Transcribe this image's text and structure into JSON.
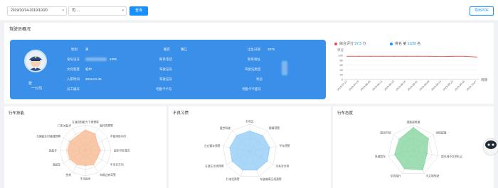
{
  "toolbar": {
    "date_range": "2019/10/14-2019/10/20",
    "driver_select": "司 …",
    "query_label": "查询",
    "export_label": "导出PDF"
  },
  "overview": {
    "title": "驾驶员概况",
    "name": "张",
    "company": "一公司",
    "fields": [
      {
        "label": "性别",
        "value": "男"
      },
      {
        "label": "身份证号",
        "value": "4355"
      },
      {
        "label": "文化程度",
        "value": "初中"
      },
      {
        "label": "入职时间",
        "value": "2015.01.25"
      },
      {
        "label": "员工编号",
        "value": ""
      },
      {
        "label": "籍贯",
        "value": "镇江"
      },
      {
        "label": "联系电话",
        "value": ""
      },
      {
        "label": "驾驶证号",
        "value": ""
      },
      {
        "label": "驾驶证号",
        "value": ""
      },
      {
        "label": "考勤卡卡号",
        "value": ""
      },
      {
        "label": "出生日期",
        "value": "1975."
      },
      {
        "label": "联系地址",
        "value": ""
      },
      {
        "label": "驾驶证类型",
        "value": ""
      },
      {
        "label": "状态",
        "value": ""
      },
      {
        "label": "考勤卡卡面号",
        "value": ""
      }
    ]
  },
  "score": {
    "composite_label": "综合评分",
    "composite_value": "97.5",
    "composite_unit": "分",
    "rank_label": "排名 第",
    "rank_value": "11/20",
    "rank_unit": "名",
    "ylabel": "评分",
    "xlabel": "周期",
    "colors": {
      "composite": "#e0524f",
      "rank": "#1890ff"
    }
  },
  "chart_data": [
    {
      "type": "line",
      "ylabel": "评分",
      "xlabel": "周期",
      "ylim": [
        0,
        100
      ],
      "yticks": [
        100,
        80,
        60,
        40,
        20,
        0
      ],
      "x": [
        "2019-07-22",
        "2019-07-29",
        "2019-08-05",
        "2019-08-12",
        "2019-08-19",
        "2019-08-26",
        "2019-09-02",
        "2019-09-09",
        "2019-09-16",
        "2019-09-23",
        "2019-09-30",
        "2019-10-07"
      ],
      "series": [
        {
          "values": [
            96,
            96,
            96,
            96,
            96,
            96,
            96,
            96,
            95,
            96,
            96,
            93
          ]
        }
      ]
    },
    {
      "type": "radar",
      "title": "行车技能",
      "axes": [
        "车速控制能力下降预警",
        "急转弯预警",
        "不使用转向灯",
        "起步存在溜车",
        "不当打方向",
        "车辆过转弯警",
        "不当起步",
        "急刹",
        "急超车",
        "急起步",
        "车辆超车时碰撞预警",
        "门未关起步"
      ],
      "values": [
        0.8,
        0.75,
        0.55,
        0.6,
        0.55,
        0.65,
        0.6,
        0.65,
        0.7,
        0.7,
        0.7,
        0.65
      ],
      "color": "#f7b58c"
    },
    {
      "type": "radar",
      "title": "不良习惯",
      "axes": [
        "打哈欠",
        "眼睛预警",
        "平车预警",
        "未系安全带",
        "车道偏离压线预警",
        "打电话预警",
        "车道左压线预警",
        "左右撞车预警",
        "疲劳驾驶"
      ],
      "values": [
        0.75,
        0.75,
        0.75,
        0.75,
        0.75,
        0.75,
        0.75,
        0.75,
        0.75
      ],
      "color": "#8ec9f5"
    },
    {
      "type": "radar",
      "title": "行车态度",
      "axes": [
        "道路超限速",
        "全程超速",
        "超光线不文明礼让",
        "不文明驾驶",
        "空挡滑行",
        "急速超车",
        "超长时间"
      ],
      "values": [
        0.9,
        0.75,
        0.55,
        0.85,
        0.8,
        0.75,
        0.7
      ],
      "color": "#7fd39a"
    }
  ],
  "cards": {
    "skill_title": "行车技能",
    "habit_title": "不良习惯",
    "attitude_title": "行车态度"
  }
}
